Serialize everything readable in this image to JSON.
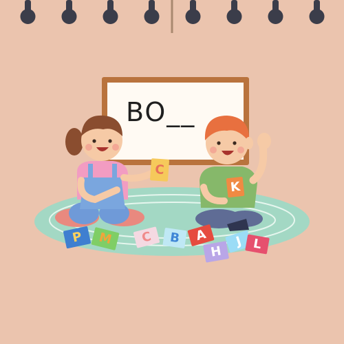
{
  "board": {
    "text": "BO__"
  },
  "hand_cards": {
    "girl": {
      "letter": "C",
      "color": "#f6c95b",
      "ink": "#e8705a"
    },
    "boy": {
      "letter": "K",
      "color": "#f08a43",
      "ink": "#ffffff"
    }
  },
  "floor_cards": [
    {
      "letter": "P",
      "color": "#3f7fd0",
      "ink": "#ffd15c"
    },
    {
      "letter": "M",
      "color": "#7fce66",
      "ink": "#f3a43a"
    },
    {
      "letter": "C",
      "color": "#f4d9e2",
      "ink": "#f08a8a"
    },
    {
      "letter": "B",
      "color": "#bfe8f5",
      "ink": "#3f86d6"
    },
    {
      "letter": "A",
      "color": "#e64b3f",
      "ink": "#ffffff"
    },
    {
      "letter": "H",
      "color": "#b9a6e7",
      "ink": "#ffffff"
    },
    {
      "letter": "J",
      "color": "#9bdcf6",
      "ink": "#ffffff"
    },
    {
      "letter": "L",
      "color": "#e6506e",
      "ink": "#ffffff"
    }
  ],
  "colors": {
    "background": "#ebc4ae",
    "rug": "#a3d8c4",
    "board_frame": "#b9733d",
    "board_surface": "#fffaf3",
    "rings": "#3b3d4a"
  }
}
